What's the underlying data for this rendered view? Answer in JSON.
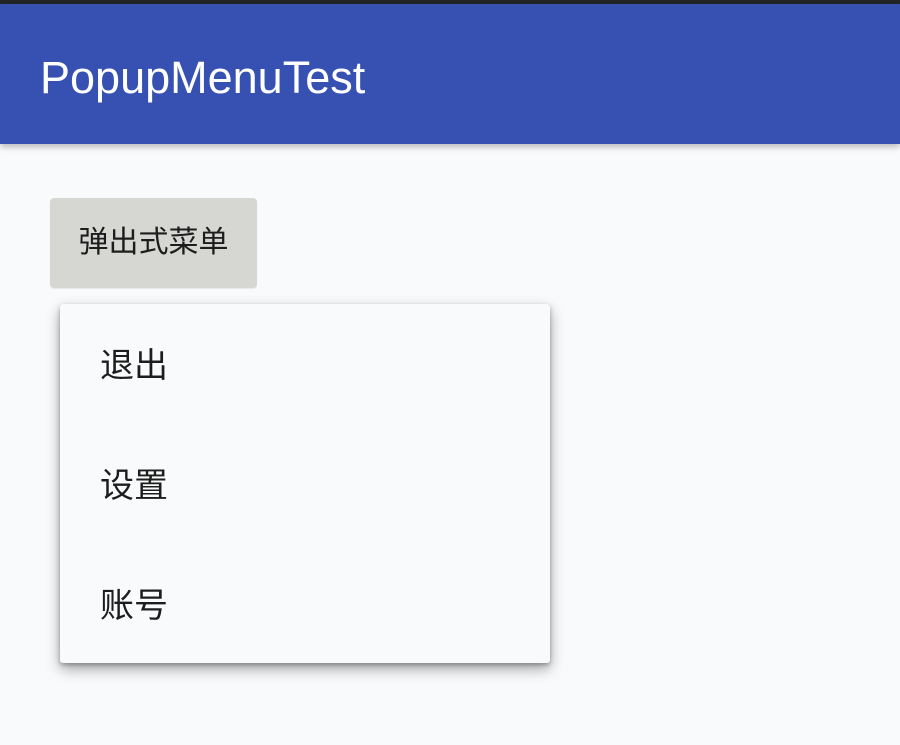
{
  "app_bar": {
    "title": "PopupMenuTest",
    "color": "#3651b2"
  },
  "main": {
    "popup_button_label": "弹出式菜单"
  },
  "popup_menu": {
    "items": [
      {
        "label": "退出"
      },
      {
        "label": "设置"
      },
      {
        "label": "账号"
      }
    ]
  }
}
